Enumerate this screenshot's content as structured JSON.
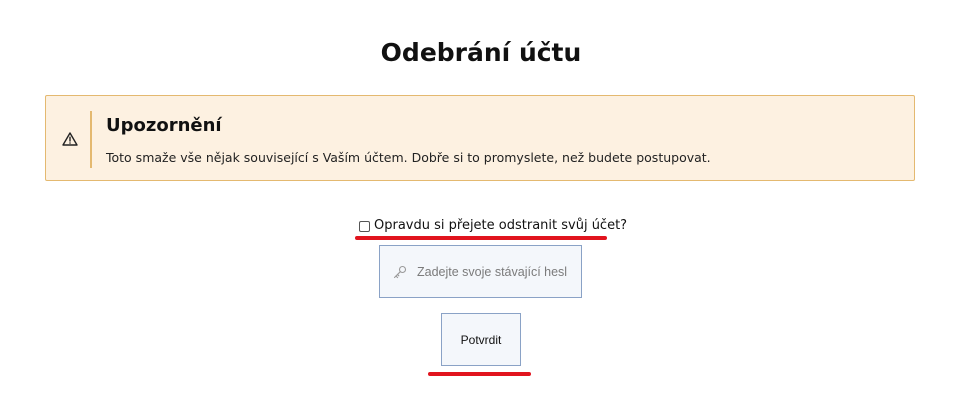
{
  "page": {
    "title": "Odebrání účtu"
  },
  "warning": {
    "icon": "warning-triangle-icon",
    "title": "Upozornění",
    "text": "Toto smaže vše nějak související s Vaším účtem. Dobře si to promyslete, než budete postupovat.",
    "background_color": "#fdf1e1",
    "border_color": "#e4b970"
  },
  "confirm": {
    "checked": false,
    "label": "Opravdu si přejete odstranit svůj účet?"
  },
  "password": {
    "icon": "key-icon",
    "value": "",
    "placeholder": "Zadejte svoje stávající heslo"
  },
  "submit": {
    "label": "Potvrdit"
  },
  "annotations": {
    "underline_color": "#e1141e"
  }
}
